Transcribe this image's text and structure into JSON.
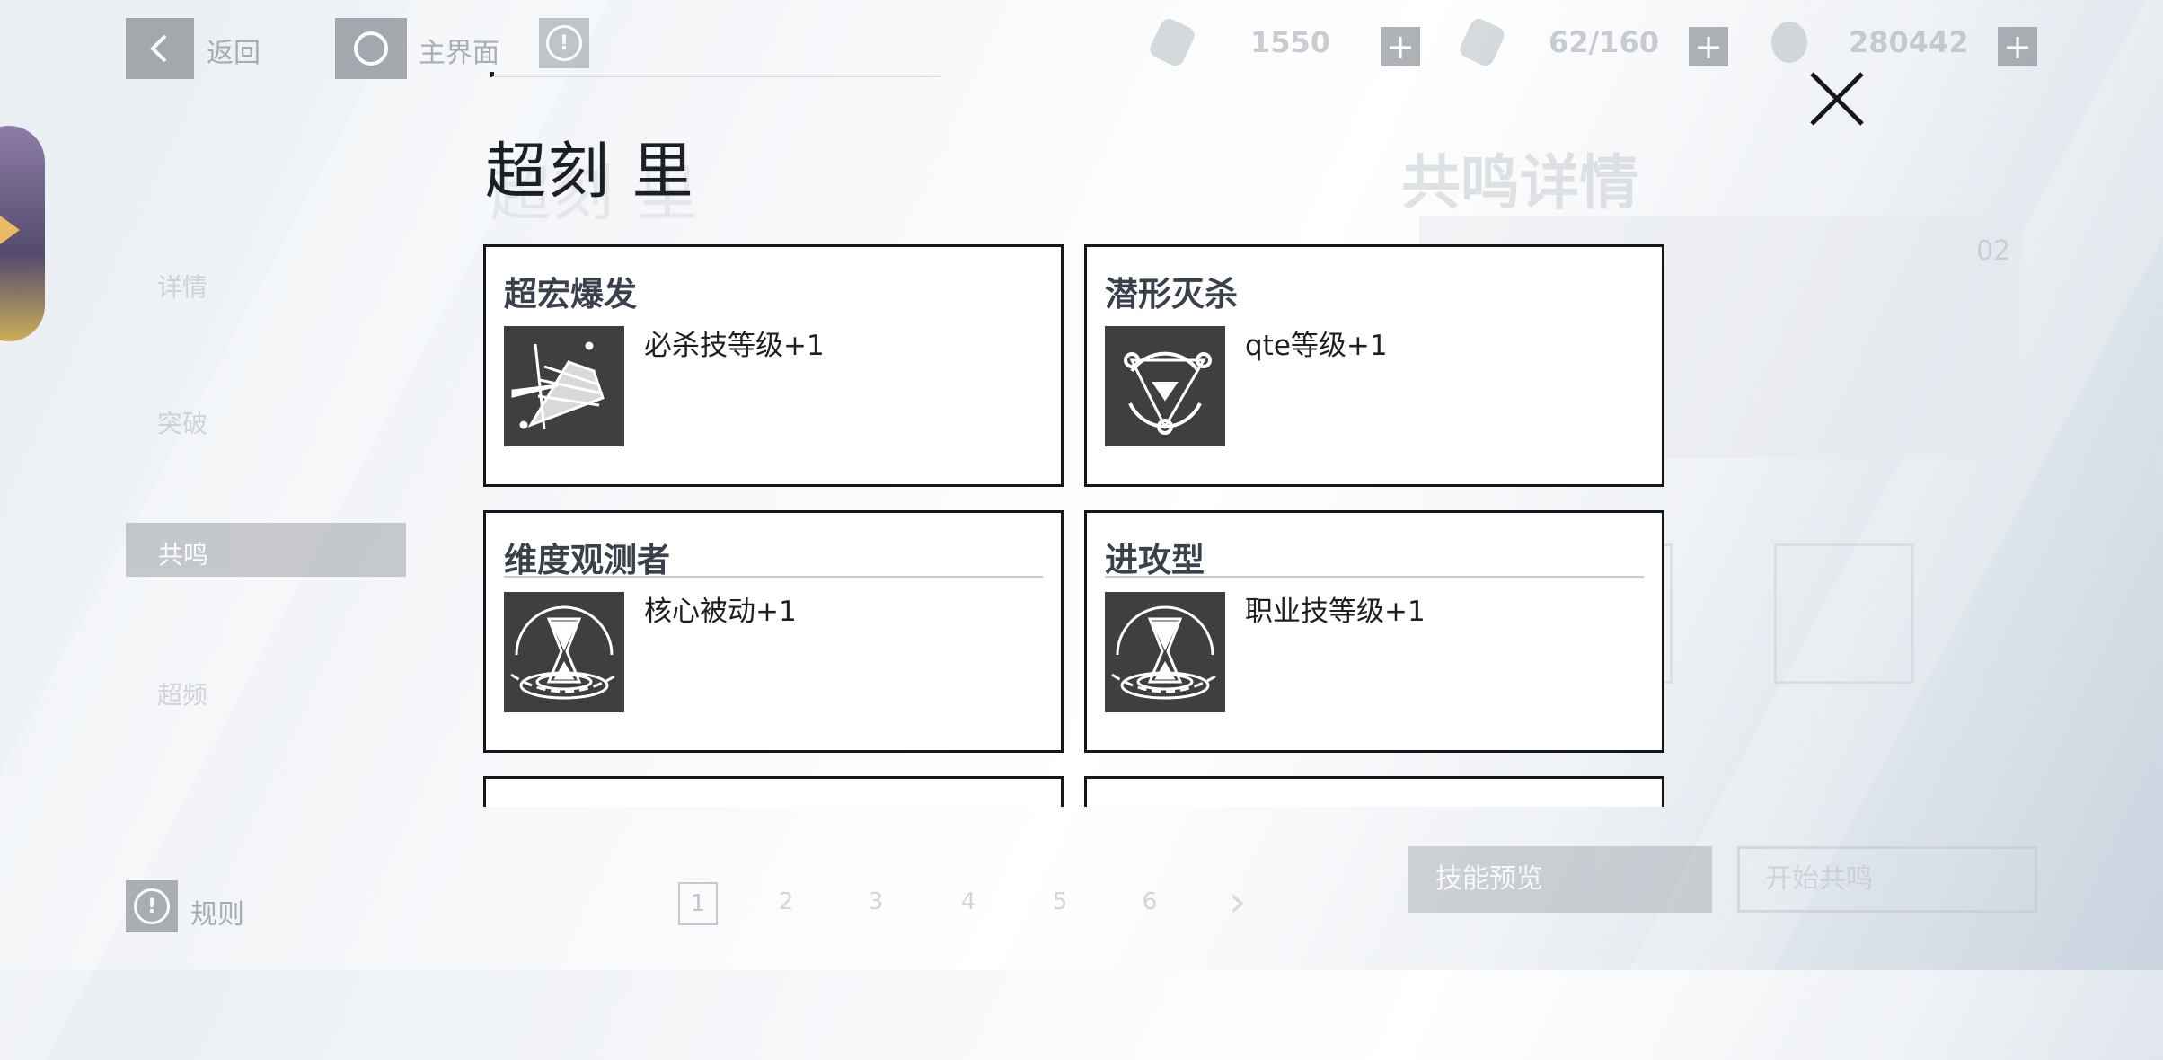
{
  "topbar": {
    "back_label": "返回",
    "home_label": "主界面",
    "resources": [
      {
        "icon": "crystal-icon",
        "value": "1550"
      },
      {
        "icon": "stamina-icon",
        "value": "62/160"
      },
      {
        "icon": "coin-icon",
        "value": "280442"
      }
    ]
  },
  "background": {
    "title": "共鸣详情",
    "side_items": [
      "详情",
      "突破",
      "共鸣",
      "超频"
    ],
    "panel_number": "02",
    "pages": [
      "1",
      "2",
      "3",
      "4",
      "5",
      "6"
    ],
    "active_page": "1",
    "skill_preview_label": "技能预览",
    "start_label": "开始共鸣",
    "rules_label": "规则"
  },
  "modal": {
    "title": "超刻 里",
    "cards": [
      {
        "title": "超宏爆发",
        "desc": "必杀技等级+1",
        "icon": "burst-blade-icon"
      },
      {
        "title": "潜形灭杀",
        "desc": "qte等级+1",
        "icon": "triangle-target-icon"
      },
      {
        "title": "维度观测者",
        "desc": "核心被动+1",
        "icon": "hourglass-icon"
      },
      {
        "title": "进攻型",
        "desc": "职业技等级+1",
        "icon": "hourglass-icon"
      }
    ]
  }
}
